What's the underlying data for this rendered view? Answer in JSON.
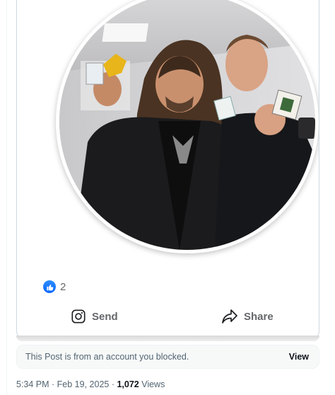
{
  "post": {
    "image_alt": "Two men holding small cards in a room",
    "reactions": {
      "icon": "thumbs-up-icon",
      "count": "2",
      "color": "#0866ff"
    },
    "actions": [
      {
        "icon": "instagram-icon",
        "label": "Send"
      },
      {
        "icon": "share-arrow-icon",
        "label": "Share"
      }
    ]
  },
  "blocked_notice": {
    "text": "This Post is from an account you blocked.",
    "view_label": "View"
  },
  "meta": {
    "time": "5:34 PM",
    "separator": " · ",
    "date": "Feb 19, 2025",
    "views_count": "1,072",
    "views_label": "Views"
  }
}
